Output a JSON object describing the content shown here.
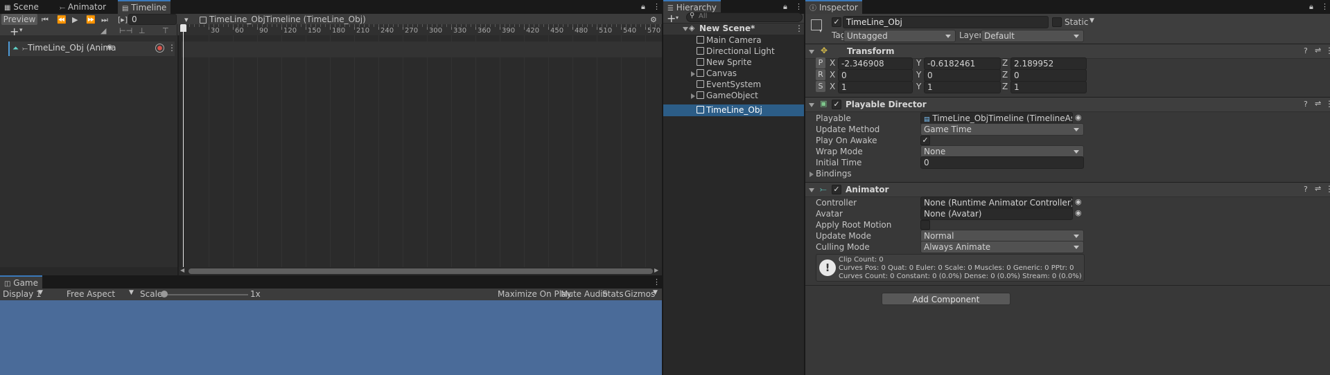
{
  "timeline_panel": {
    "tabs": [
      "Scene",
      "Animator",
      "Timeline"
    ],
    "preview_label": "Preview",
    "frame_value": "0",
    "asset_path": "TimeLine_ObjTimeline (TimeLine_Obj)",
    "ruler_ticks": [
      "30",
      "60",
      "90",
      "120",
      "150",
      "180",
      "210",
      "240",
      "270",
      "300",
      "330",
      "360",
      "390",
      "420",
      "450",
      "480",
      "510",
      "540",
      "570"
    ],
    "track_label": "TimeLine_Obj (Animator"
  },
  "game_panel": {
    "tab": "Game",
    "display": "Display 1",
    "aspect": "Free Aspect",
    "scale_label": "Scale",
    "scale_value": "1x",
    "buttons": [
      "Maximize On Play",
      "Mute Audio",
      "Stats",
      "Gizmos"
    ]
  },
  "hierarchy": {
    "tab": "Hierarchy",
    "search_placeholder": "All",
    "scene_name": "New Scene*",
    "items": [
      "Main Camera",
      "Directional Light",
      "New Sprite",
      "Canvas",
      "EventSystem",
      "GameObject",
      "TimeLine_Obj"
    ],
    "selected": "TimeLine_Obj"
  },
  "inspector": {
    "tab": "Inspector",
    "object_name": "TimeLine_Obj",
    "static_label": "Static",
    "tag_label": "Tag",
    "tag_value": "Untagged",
    "layer_label": "Layer",
    "layer_value": "Default",
    "transform": {
      "title": "Transform",
      "rows": [
        {
          "key": "P",
          "x": "-2.346908",
          "y": "-0.6182461",
          "z": "2.189952"
        },
        {
          "key": "R",
          "x": "0",
          "y": "0",
          "z": "0"
        },
        {
          "key": "S",
          "x": "1",
          "y": "1",
          "z": "1"
        }
      ],
      "axis_x": "X",
      "axis_y": "Y",
      "axis_z": "Z"
    },
    "playable_director": {
      "title": "Playable Director",
      "playable_label": "Playable",
      "playable_value": "TimeLine_ObjTimeline (TimelineAsset)",
      "update_method_label": "Update Method",
      "update_method_value": "Game Time",
      "play_on_awake_label": "Play On Awake",
      "wrap_mode_label": "Wrap Mode",
      "wrap_mode_value": "None",
      "initial_time_label": "Initial Time",
      "initial_time_value": "0",
      "bindings_label": "Bindings"
    },
    "animator": {
      "title": "Animator",
      "controller_label": "Controller",
      "controller_value": "None (Runtime Animator Controller)",
      "avatar_label": "Avatar",
      "avatar_value": "None (Avatar)",
      "apply_root_motion_label": "Apply Root Motion",
      "update_mode_label": "Update Mode",
      "update_mode_value": "Normal",
      "culling_mode_label": "Culling Mode",
      "culling_mode_value": "Always Animate",
      "info_line1": "Clip Count: 0",
      "info_line2": "Curves Pos: 0 Quat: 0 Euler: 0 Scale: 0 Muscles: 0 Generic: 0 PPtr: 0",
      "info_line3": "Curves Count: 0 Constant: 0 (0.0%) Dense: 0 (0.0%) Stream: 0 (0.0%)"
    },
    "add_component_label": "Add Component"
  }
}
